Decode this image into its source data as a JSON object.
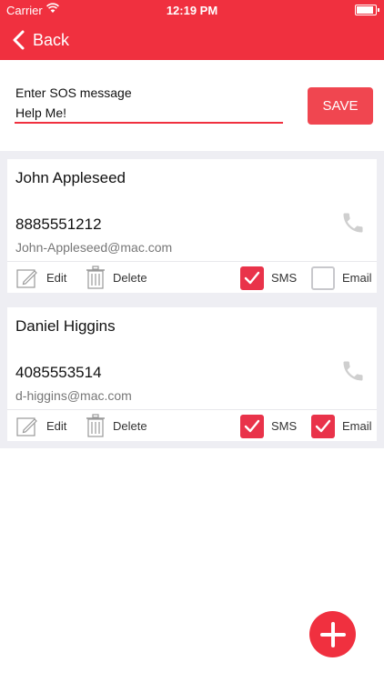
{
  "status_bar": {
    "carrier": "Carrier",
    "time": "12:19 PM",
    "battery_level": 0.9
  },
  "nav": {
    "back_label": "Back"
  },
  "sos": {
    "label": "Enter SOS message",
    "message": "Help Me!",
    "save_label": "SAVE"
  },
  "contacts": [
    {
      "name": "John Appleseed",
      "phone": "8885551212",
      "email": "John-Appleseed@mac.com",
      "edit_label": "Edit",
      "delete_label": "Delete",
      "sms_label": "SMS",
      "sms_checked": true,
      "email_label": "Email",
      "email_checked": false
    },
    {
      "name": "Daniel Higgins",
      "phone": "4085553514",
      "email": "d-higgins@mac.com",
      "edit_label": "Edit",
      "delete_label": "Delete",
      "sms_label": "SMS",
      "sms_checked": true,
      "email_label": "Email",
      "email_checked": true
    }
  ],
  "colors": {
    "accent": "#f0303f",
    "button": "#f04650",
    "checkbox_on": "#e9334a",
    "list_background": "#eeeef3"
  },
  "icons": {
    "back": "chevron-left-icon",
    "phone": "phone-icon",
    "edit": "pencil-icon",
    "delete": "trash-icon",
    "check": "checkmark-icon",
    "add": "plus-icon"
  }
}
